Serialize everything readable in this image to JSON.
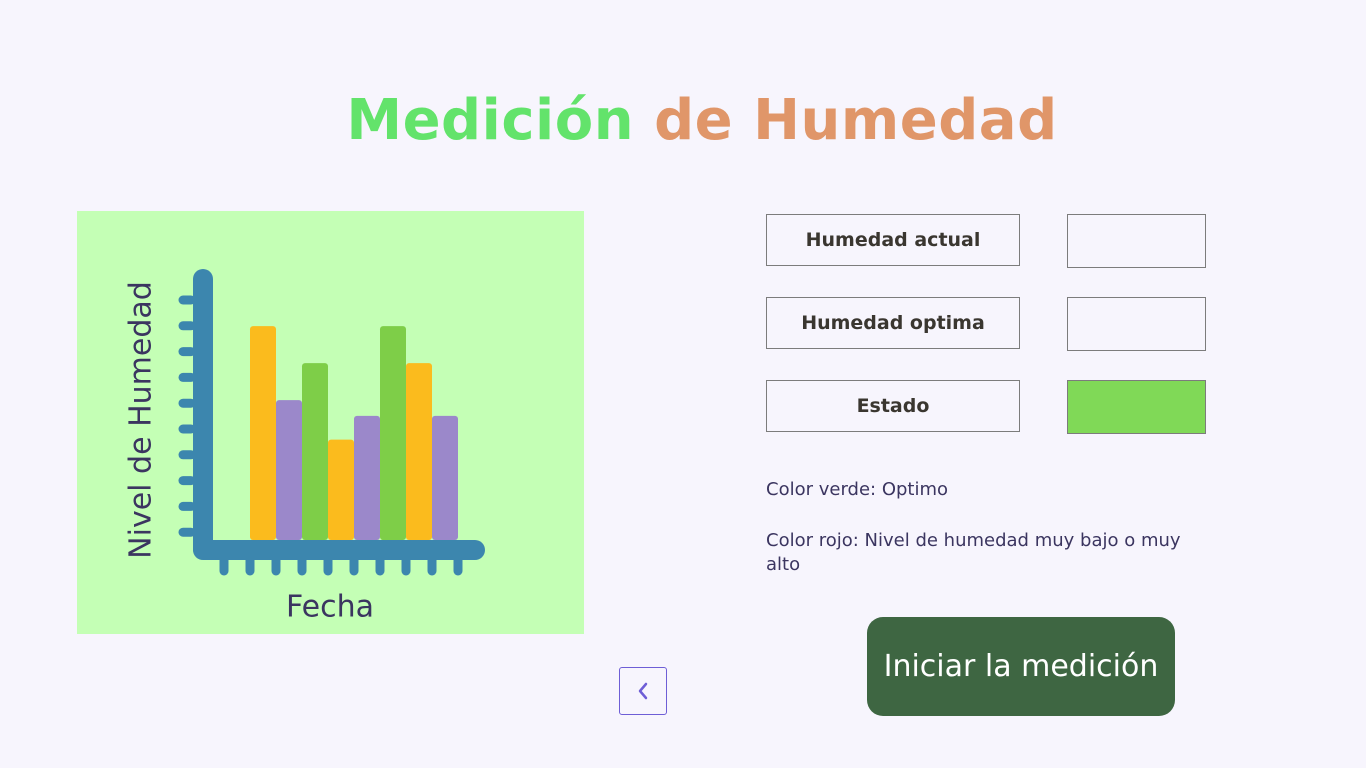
{
  "title": {
    "part1": "Medición",
    "part2": "de Humedad"
  },
  "illustration": {
    "ylabel": "Nivel de Humedad",
    "xlabel": "Fecha",
    "bar_levels": [
      0.81,
      0.53,
      0.67,
      0.38,
      0.47,
      0.81,
      0.67,
      0.47
    ],
    "bar_colors": [
      "#fbbb1d",
      "#9b88ca",
      "#7ece48",
      "#fbbb1d",
      "#9b88ca",
      "#7ece48",
      "#fbbb1d",
      "#9b88ca"
    ],
    "axis_color": "#3c86ae",
    "background": "#c4ffb5"
  },
  "fields": {
    "humedad_actual": {
      "label": "Humedad actual",
      "value": ""
    },
    "humedad_optima": {
      "label": "Humedad optima",
      "value": ""
    },
    "estado": {
      "label": "Estado",
      "value": "",
      "color": "#80d957"
    }
  },
  "legend": {
    "green": "Color verde: Optimo",
    "red": "Color rojo: Nivel de humedad muy bajo o muy alto"
  },
  "buttons": {
    "start_label": "Iniciar la medición",
    "back_icon": "chevron-left-icon"
  },
  "colors": {
    "title_green": "#63e36b",
    "title_orange": "#e09669",
    "button_bg": "#3e6642",
    "back_border": "#6e5ed6"
  }
}
